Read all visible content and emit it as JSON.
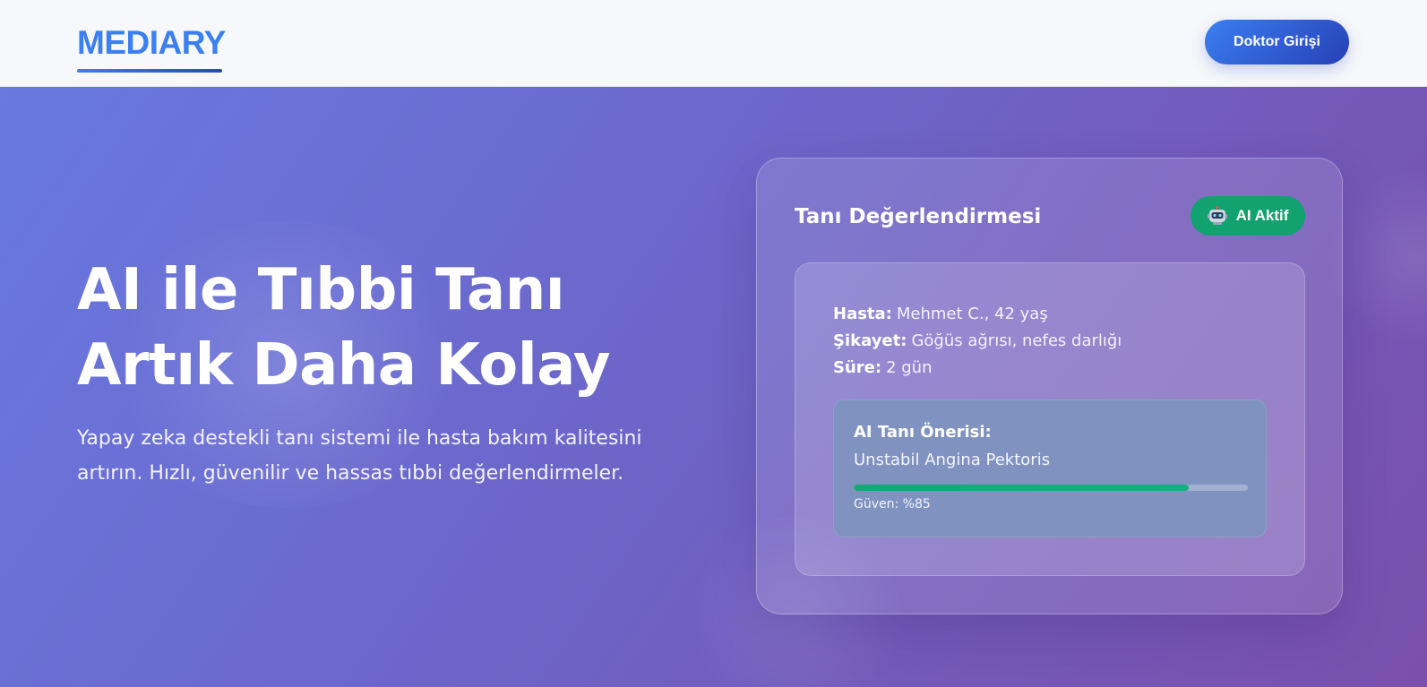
{
  "navbar": {
    "logo": "MEDIARY",
    "login_button": "Doktor Girişi"
  },
  "hero": {
    "title_line1": "AI ile Tıbbi Tanı",
    "title_line2": "Artık Daha Kolay",
    "subtitle": "Yapay zeka destekli tanı sistemi ile hasta bakım kalitesini artırın. Hızlı, güvenilir ve hassas tıbbi değerlendirmeler."
  },
  "card": {
    "title": "Tanı Değerlendirmesi",
    "badge_icon": "robot-icon",
    "badge_label": "AI Aktif",
    "patient": {
      "name_label": "Hasta:",
      "name_value": "Mehmet C., 42 yaş",
      "complaint_label": "Şikayet:",
      "complaint_value": "Göğüs ağrısı, nefes darlığı",
      "duration_label": "Süre:",
      "duration_value": "2 gün"
    },
    "diagnosis": {
      "label": "AI Tanı Önerisi:",
      "value": "Unstabil Angina Pektoris",
      "confidence_percent": 85,
      "confidence_text": "Güven: %85"
    }
  },
  "colors": {
    "brand_blue": "#3b7ff0",
    "badge_green": "#12a26f",
    "hero_start": "#6879e0",
    "hero_end": "#7a50ac"
  }
}
